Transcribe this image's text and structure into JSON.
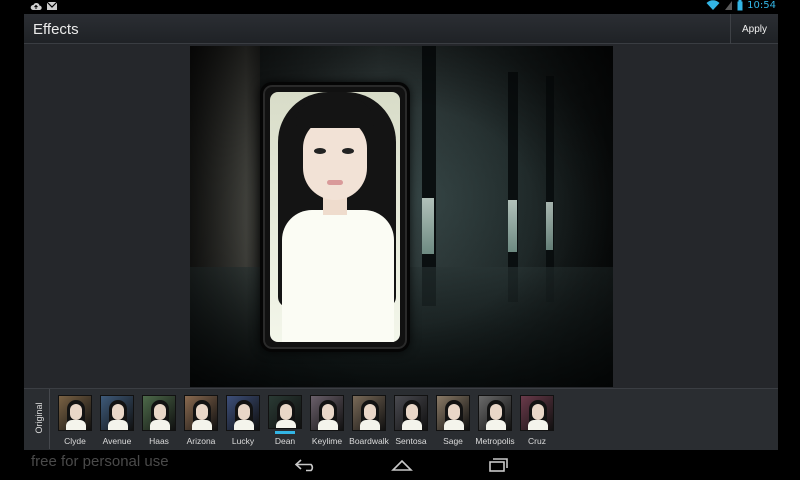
{
  "status_bar": {
    "time": "10:54",
    "icons_left": [
      "cloud-upload-icon",
      "gmail-icon"
    ],
    "icons_right": [
      "wifi-icon",
      "signal-icon",
      "battery-icon"
    ]
  },
  "action_bar": {
    "title": "Effects",
    "apply_label": "Apply"
  },
  "filmstrip": {
    "original_label": "Original",
    "selected": "Dean",
    "effects": [
      {
        "label": "Clyde",
        "tint": "#7a6244"
      },
      {
        "label": "Avenue",
        "tint": "#3e5a7a"
      },
      {
        "label": "Haas",
        "tint": "#4d6a4a"
      },
      {
        "label": "Arizona",
        "tint": "#8a6a50"
      },
      {
        "label": "Lucky",
        "tint": "#3d4f7a"
      },
      {
        "label": "Dean",
        "tint": "#2a3a34"
      },
      {
        "label": "Keylime",
        "tint": "#6a5f6a"
      },
      {
        "label": "Boardwalk",
        "tint": "#7a6a58"
      },
      {
        "label": "Sentosa",
        "tint": "#4a4a50"
      },
      {
        "label": "Sage",
        "tint": "#8a7a66"
      },
      {
        "label": "Metropolis",
        "tint": "#6a6a6a"
      },
      {
        "label": "Cruz",
        "tint": "#6a3a4a"
      }
    ]
  },
  "watermark": "free for personal use",
  "nav": {
    "icons": [
      "back-icon",
      "home-icon",
      "recent-apps-icon"
    ]
  },
  "colors": {
    "accent": "#33b5e5"
  }
}
